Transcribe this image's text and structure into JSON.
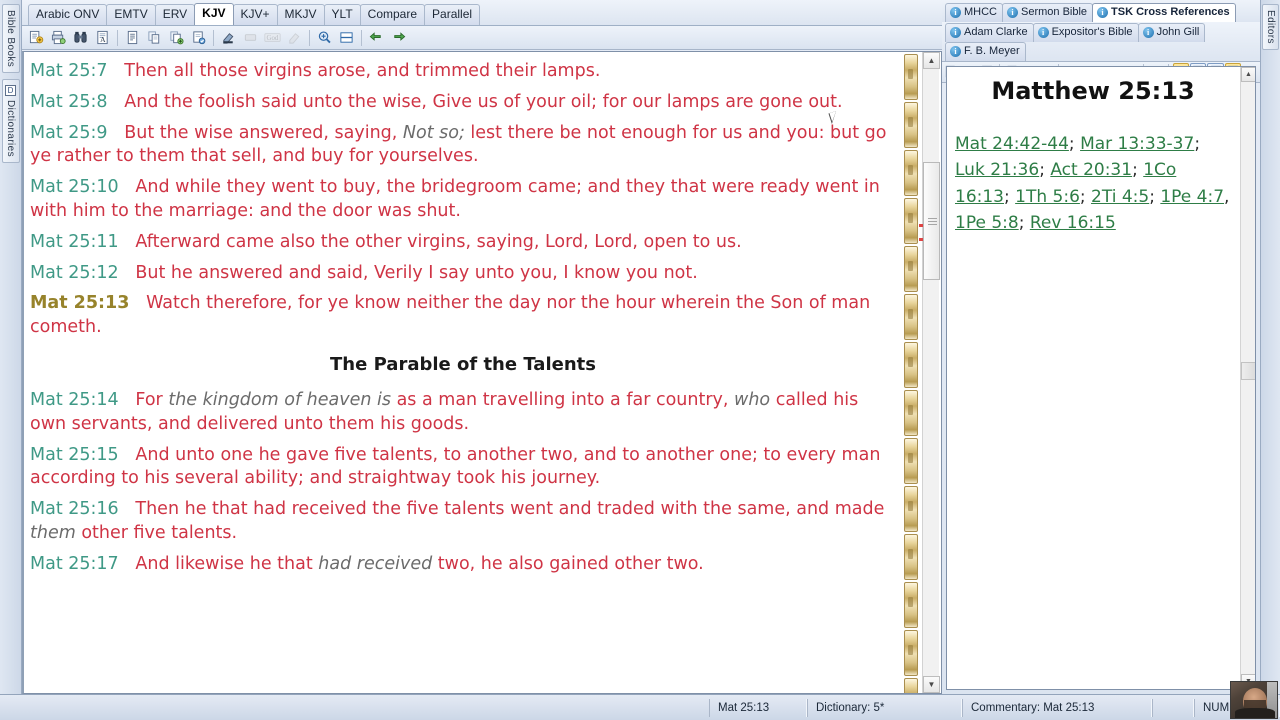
{
  "app": {
    "left_dock": [
      {
        "label": "Bible Books",
        "icon": "book-icon",
        "active": false
      },
      {
        "label": "Dictionaries",
        "icon": "dictionary-icon",
        "active": true
      }
    ],
    "right_dock": [
      {
        "label": "Editors",
        "icon": "editors-icon"
      }
    ]
  },
  "bible": {
    "tabs": [
      {
        "label": "Arabic ONV",
        "active": false
      },
      {
        "label": "EMTV",
        "active": false
      },
      {
        "label": "ERV",
        "active": false
      },
      {
        "label": "KJV",
        "active": true
      },
      {
        "label": "KJV+",
        "active": false
      },
      {
        "label": "MKJV",
        "active": false
      },
      {
        "label": "YLT",
        "active": false
      },
      {
        "label": "Compare",
        "active": false
      },
      {
        "label": "Parallel",
        "active": false
      }
    ],
    "toolbar": [
      {
        "name": "new-window-icon",
        "glyph": "⧉",
        "state": "normal"
      },
      {
        "name": "print-icon",
        "glyph": "⎙",
        "state": "normal"
      },
      {
        "name": "search-binoculars-icon",
        "glyph": "෴",
        "state": "normal"
      },
      {
        "name": "search-page-icon",
        "glyph": "Ⓐ",
        "state": "normal"
      },
      {
        "name": "sep",
        "glyph": "",
        "state": "separator"
      },
      {
        "name": "notes-icon",
        "glyph": "≡",
        "state": "normal"
      },
      {
        "name": "copy-icon",
        "glyph": "⧉",
        "state": "normal"
      },
      {
        "name": "copy-verse-icon",
        "glyph": "⎘",
        "state": "normal"
      },
      {
        "name": "paste-verse-icon",
        "glyph": "⎙",
        "state": "normal"
      },
      {
        "name": "sep",
        "glyph": "",
        "state": "separator"
      },
      {
        "name": "highlight-icon",
        "glyph": "✎",
        "state": "normal"
      },
      {
        "name": "highlight-clear-icon",
        "glyph": "▭",
        "state": "disabled"
      },
      {
        "name": "strongs-god-icon",
        "glyph": "God",
        "state": "disabled"
      },
      {
        "name": "verse-ref-icon",
        "glyph": "▭",
        "state": "disabled"
      },
      {
        "name": "sep",
        "glyph": "",
        "state": "separator"
      },
      {
        "name": "zoom-in-icon",
        "glyph": "⊕",
        "state": "normal"
      },
      {
        "name": "split-view-icon",
        "glyph": "▤",
        "state": "normal"
      },
      {
        "name": "sep",
        "glyph": "",
        "state": "separator"
      },
      {
        "name": "nav-back-icon",
        "glyph": "↶",
        "state": "normal"
      },
      {
        "name": "nav-forward-icon",
        "glyph": "↷",
        "state": "normal"
      }
    ],
    "verses": [
      {
        "ref": "Mat 25:7",
        "active": false,
        "parts": [
          {
            "t": "Then all those virgins arose, and trimmed their lamps.",
            "i": false
          }
        ]
      },
      {
        "ref": "Mat 25:8",
        "active": false,
        "parts": [
          {
            "t": "And the foolish said unto the wise, Give us of your oil; for our lamps are gone out.",
            "i": false
          }
        ]
      },
      {
        "ref": "Mat 25:9",
        "active": false,
        "parts": [
          {
            "t": "But the wise answered, saying, ",
            "i": false
          },
          {
            "t": "Not so;",
            "i": true
          },
          {
            "t": " lest there be not enough for us and you: but go ye rather to them that sell, and buy for yourselves.",
            "i": false
          }
        ]
      },
      {
        "ref": "Mat 25:10",
        "active": false,
        "parts": [
          {
            "t": "And while they went to buy, the bridegroom came; and they that were ready went in with him to the marriage: and the door was shut.",
            "i": false
          }
        ]
      },
      {
        "ref": "Mat 25:11",
        "active": false,
        "parts": [
          {
            "t": "Afterward came also the other virgins, saying, Lord, Lord, open to us.",
            "i": false
          }
        ]
      },
      {
        "ref": "Mat 25:12",
        "active": false,
        "parts": [
          {
            "t": "But he answered and said, Verily I say unto you, I know you not.",
            "i": false
          }
        ]
      },
      {
        "ref": "Mat 25:13",
        "active": true,
        "parts": [
          {
            "t": "Watch therefore, for ye know neither the day nor the hour wherein the Son of man cometh.",
            "i": false
          }
        ]
      }
    ],
    "section_heading": "The Parable of the Talents",
    "verses_after": [
      {
        "ref": "Mat 25:14",
        "active": false,
        "parts": [
          {
            "t": "For ",
            "i": false
          },
          {
            "t": "the kingdom of heaven is",
            "i": true
          },
          {
            "t": " as a man travelling into a far country, ",
            "i": false
          },
          {
            "t": "who",
            "i": true
          },
          {
            "t": " called his own servants, and delivered unto them his goods.",
            "i": false
          }
        ]
      },
      {
        "ref": "Mat 25:15",
        "active": false,
        "parts": [
          {
            "t": "And unto one he gave five talents, to another two, and to another one; to every man according to his several ability; and straightway took his journey.",
            "i": false
          }
        ]
      },
      {
        "ref": "Mat 25:16",
        "active": false,
        "parts": [
          {
            "t": "Then he that had received the five talents went and traded with the same, and made ",
            "i": false
          },
          {
            "t": "them",
            "i": true
          },
          {
            "t": " other five talents.",
            "i": false
          }
        ]
      },
      {
        "ref": "Mat 25:17",
        "active": false,
        "parts": [
          {
            "t": "And likewise he that ",
            "i": false
          },
          {
            "t": "had received",
            "i": true
          },
          {
            "t": " two, he also gained other two.",
            "i": false
          }
        ]
      }
    ]
  },
  "commentary": {
    "tabs_row1": [
      {
        "label": "MHCC",
        "active": false
      },
      {
        "label": "Sermon Bible",
        "active": false
      },
      {
        "label": "TSK Cross References",
        "active": true
      }
    ],
    "tabs_row2": [
      {
        "label": "Adam Clarke",
        "active": false
      },
      {
        "label": "Expositor's Bible",
        "active": false
      },
      {
        "label": "John Gill",
        "active": false
      },
      {
        "label": "F. B. Meyer",
        "active": false
      }
    ],
    "toolbar": [
      {
        "name": "new-window-icon",
        "glyph": "⧉",
        "state": "normal"
      },
      {
        "name": "search-binoculars-icon",
        "glyph": "෴",
        "state": "normal"
      },
      {
        "name": "search-page-icon",
        "glyph": "Ⓐ",
        "state": "normal"
      },
      {
        "name": "sep",
        "glyph": "",
        "state": "separator"
      },
      {
        "name": "notes-icon",
        "glyph": "≡",
        "state": "normal"
      },
      {
        "name": "copy-icon",
        "glyph": "⧉",
        "state": "normal"
      },
      {
        "name": "paste-verse-icon",
        "glyph": "⎙",
        "state": "normal"
      },
      {
        "name": "sep",
        "glyph": "",
        "state": "separator"
      },
      {
        "name": "highlight-icon",
        "glyph": "✎",
        "state": "normal"
      },
      {
        "name": "highlight-clear-icon",
        "glyph": "▭",
        "state": "disabled"
      },
      {
        "name": "strongs-god-icon",
        "glyph": "God",
        "state": "disabled"
      },
      {
        "name": "verse-ref-icon",
        "glyph": "▭",
        "state": "disabled"
      },
      {
        "name": "sep",
        "glyph": "",
        "state": "separator"
      },
      {
        "name": "zoom-in-icon",
        "glyph": "⊕",
        "state": "normal"
      },
      {
        "name": "sep",
        "glyph": "",
        "state": "separator"
      },
      {
        "name": "link-icon",
        "glyph": "∞",
        "state": "active"
      },
      {
        "name": "book-scope-icon",
        "glyph": "B",
        "state": "boxed"
      },
      {
        "name": "chapter-scope-icon",
        "glyph": "C",
        "state": "boxed"
      },
      {
        "name": "verse-scope-icon",
        "glyph": "V",
        "state": "active-boxed"
      }
    ],
    "title": "Matthew 25:13",
    "cross_references": [
      {
        "ref": "Mat 24:42-44",
        "sep": "; "
      },
      {
        "ref": "Mar 13:33-37",
        "sep": "; "
      },
      {
        "ref": "Luk 21:36",
        "sep": "; "
      },
      {
        "ref": "Act 20:31",
        "sep": "; "
      },
      {
        "ref": "1Co 16:13",
        "sep": "; "
      },
      {
        "ref": "1Th 5:6",
        "sep": "; "
      },
      {
        "ref": "2Ti 4:5",
        "sep": "; "
      },
      {
        "ref": "1Pe 4:7",
        "sep": ", "
      },
      {
        "ref": "1Pe 5:8",
        "sep": "; "
      },
      {
        "ref": "Rev 16:15",
        "sep": ""
      }
    ]
  },
  "statusbar": {
    "verse": "Mat 25:13",
    "dictionary": "Dictionary: 5*",
    "commentary": "Commentary: Mat 25:13",
    "numlock": "NUM"
  },
  "colors": {
    "verse_ref": "#3f9986",
    "verse_text": "#cf3445",
    "active_ref": "#97832b",
    "italic_text": "#6b6b6b",
    "xref_link": "#2e7d46",
    "chrome": "#d6e0ee"
  }
}
